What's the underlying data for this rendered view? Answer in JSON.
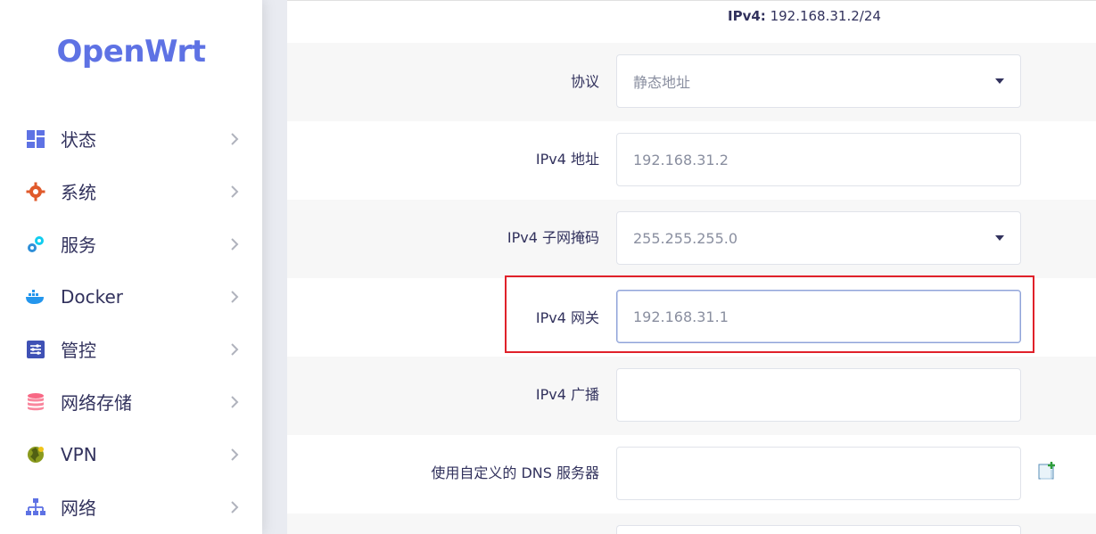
{
  "logo": "OpenWrt",
  "sidebar": {
    "items": [
      {
        "label": "状态",
        "icon": "dashboard-icon"
      },
      {
        "label": "系统",
        "icon": "gear-icon"
      },
      {
        "label": "服务",
        "icon": "services-icon"
      },
      {
        "label": "Docker",
        "icon": "docker-icon"
      },
      {
        "label": "管控",
        "icon": "sliders-icon"
      },
      {
        "label": "网络存储",
        "icon": "database-icon"
      },
      {
        "label": "VPN",
        "icon": "globe-icon"
      },
      {
        "label": "网络",
        "icon": "network-icon"
      }
    ]
  },
  "status": {
    "ipv4_label": "IPv4:",
    "ipv4_value": " 192.168.31.2/24"
  },
  "form": {
    "protocol": {
      "label": "协议",
      "value": "静态地址"
    },
    "ipv4_address": {
      "label": "IPv4 地址",
      "value": "192.168.31.2"
    },
    "ipv4_netmask": {
      "label": "IPv4 子网掩码",
      "value": "255.255.255.0"
    },
    "ipv4_gateway": {
      "label": "IPv4 网关",
      "value": "192.168.31.1"
    },
    "ipv4_broadcast": {
      "label": "IPv4 广播",
      "value": ""
    },
    "custom_dns": {
      "label": "使用自定义的 DNS 服务器",
      "value": ""
    }
  },
  "colors": {
    "accent": "#5e72e4",
    "highlight": "#e0212a"
  }
}
